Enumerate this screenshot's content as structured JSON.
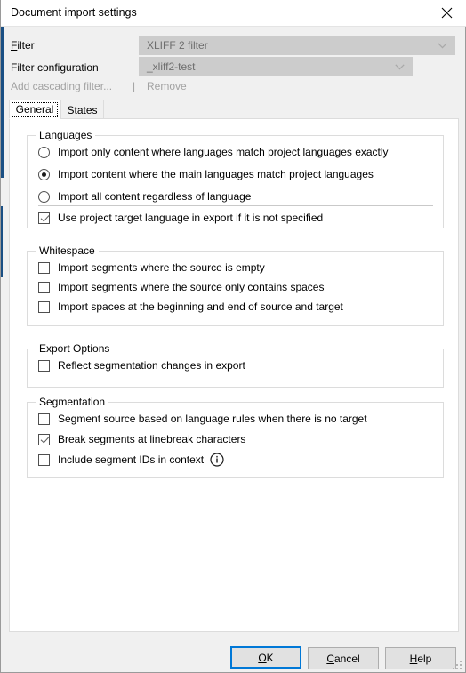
{
  "window": {
    "title": "Document import settings",
    "close_icon": "close-icon"
  },
  "form": {
    "filter_label_mnemonic": "F",
    "filter_label_rest": "ilter",
    "filter_value": "XLIFF 2 filter",
    "filter_config_label": "Filter configuration",
    "filter_config_value": "_xliff2-test",
    "add_cascading_filter": "Add cascading filter...",
    "separator": "|",
    "remove": "Remove"
  },
  "tabs": [
    {
      "label": "General",
      "active": true
    },
    {
      "label": "States",
      "active": false
    }
  ],
  "groups": [
    {
      "id": "languages",
      "title": "Languages",
      "options": [
        {
          "type": "radio",
          "label": "Import only content where languages match project languages exactly",
          "checked": false
        },
        {
          "type": "radio",
          "label": "Import content where the main languages match project languages",
          "checked": true
        },
        {
          "type": "radio",
          "label": "Import all content regardless of language",
          "checked": false
        },
        {
          "type": "checkbox",
          "label": "Use project target language in export if it is not specified",
          "checked": true
        }
      ]
    },
    {
      "id": "whitespace",
      "title": "Whitespace",
      "options": [
        {
          "type": "checkbox",
          "label": "Import segments where the source is empty",
          "checked": false
        },
        {
          "type": "checkbox",
          "label": "Import segments where the source only contains spaces",
          "checked": false
        },
        {
          "type": "checkbox",
          "label": "Import spaces at the beginning and end of source and target",
          "checked": false
        }
      ]
    },
    {
      "id": "export-options",
      "title": "Export Options",
      "options": [
        {
          "type": "checkbox",
          "label": "Reflect segmentation changes in export",
          "checked": false
        }
      ]
    },
    {
      "id": "segmentation",
      "title": "Segmentation",
      "options": [
        {
          "type": "checkbox",
          "label": "Segment source based on language rules when there is no target",
          "checked": false
        },
        {
          "type": "checkbox",
          "label": "Break segments at linebreak characters",
          "checked": true
        },
        {
          "type": "checkbox",
          "label": "Include segment IDs in context",
          "checked": false,
          "info_icon": "info-icon"
        }
      ]
    }
  ],
  "buttons": {
    "ok": {
      "mnemonic": "O",
      "rest": "K",
      "default": true
    },
    "cancel": {
      "mnemonic": "C",
      "rest": "ancel",
      "default": false
    },
    "help": {
      "mnemonic": "H",
      "rest": "elp",
      "default": false
    }
  },
  "colors": {
    "accent": "#0078d7",
    "dialog_bg": "#f0f0f0",
    "panel_bg": "#ffffff",
    "combo_disabled_bg": "#cccccc",
    "disabled_text": "#a2a2a2"
  }
}
